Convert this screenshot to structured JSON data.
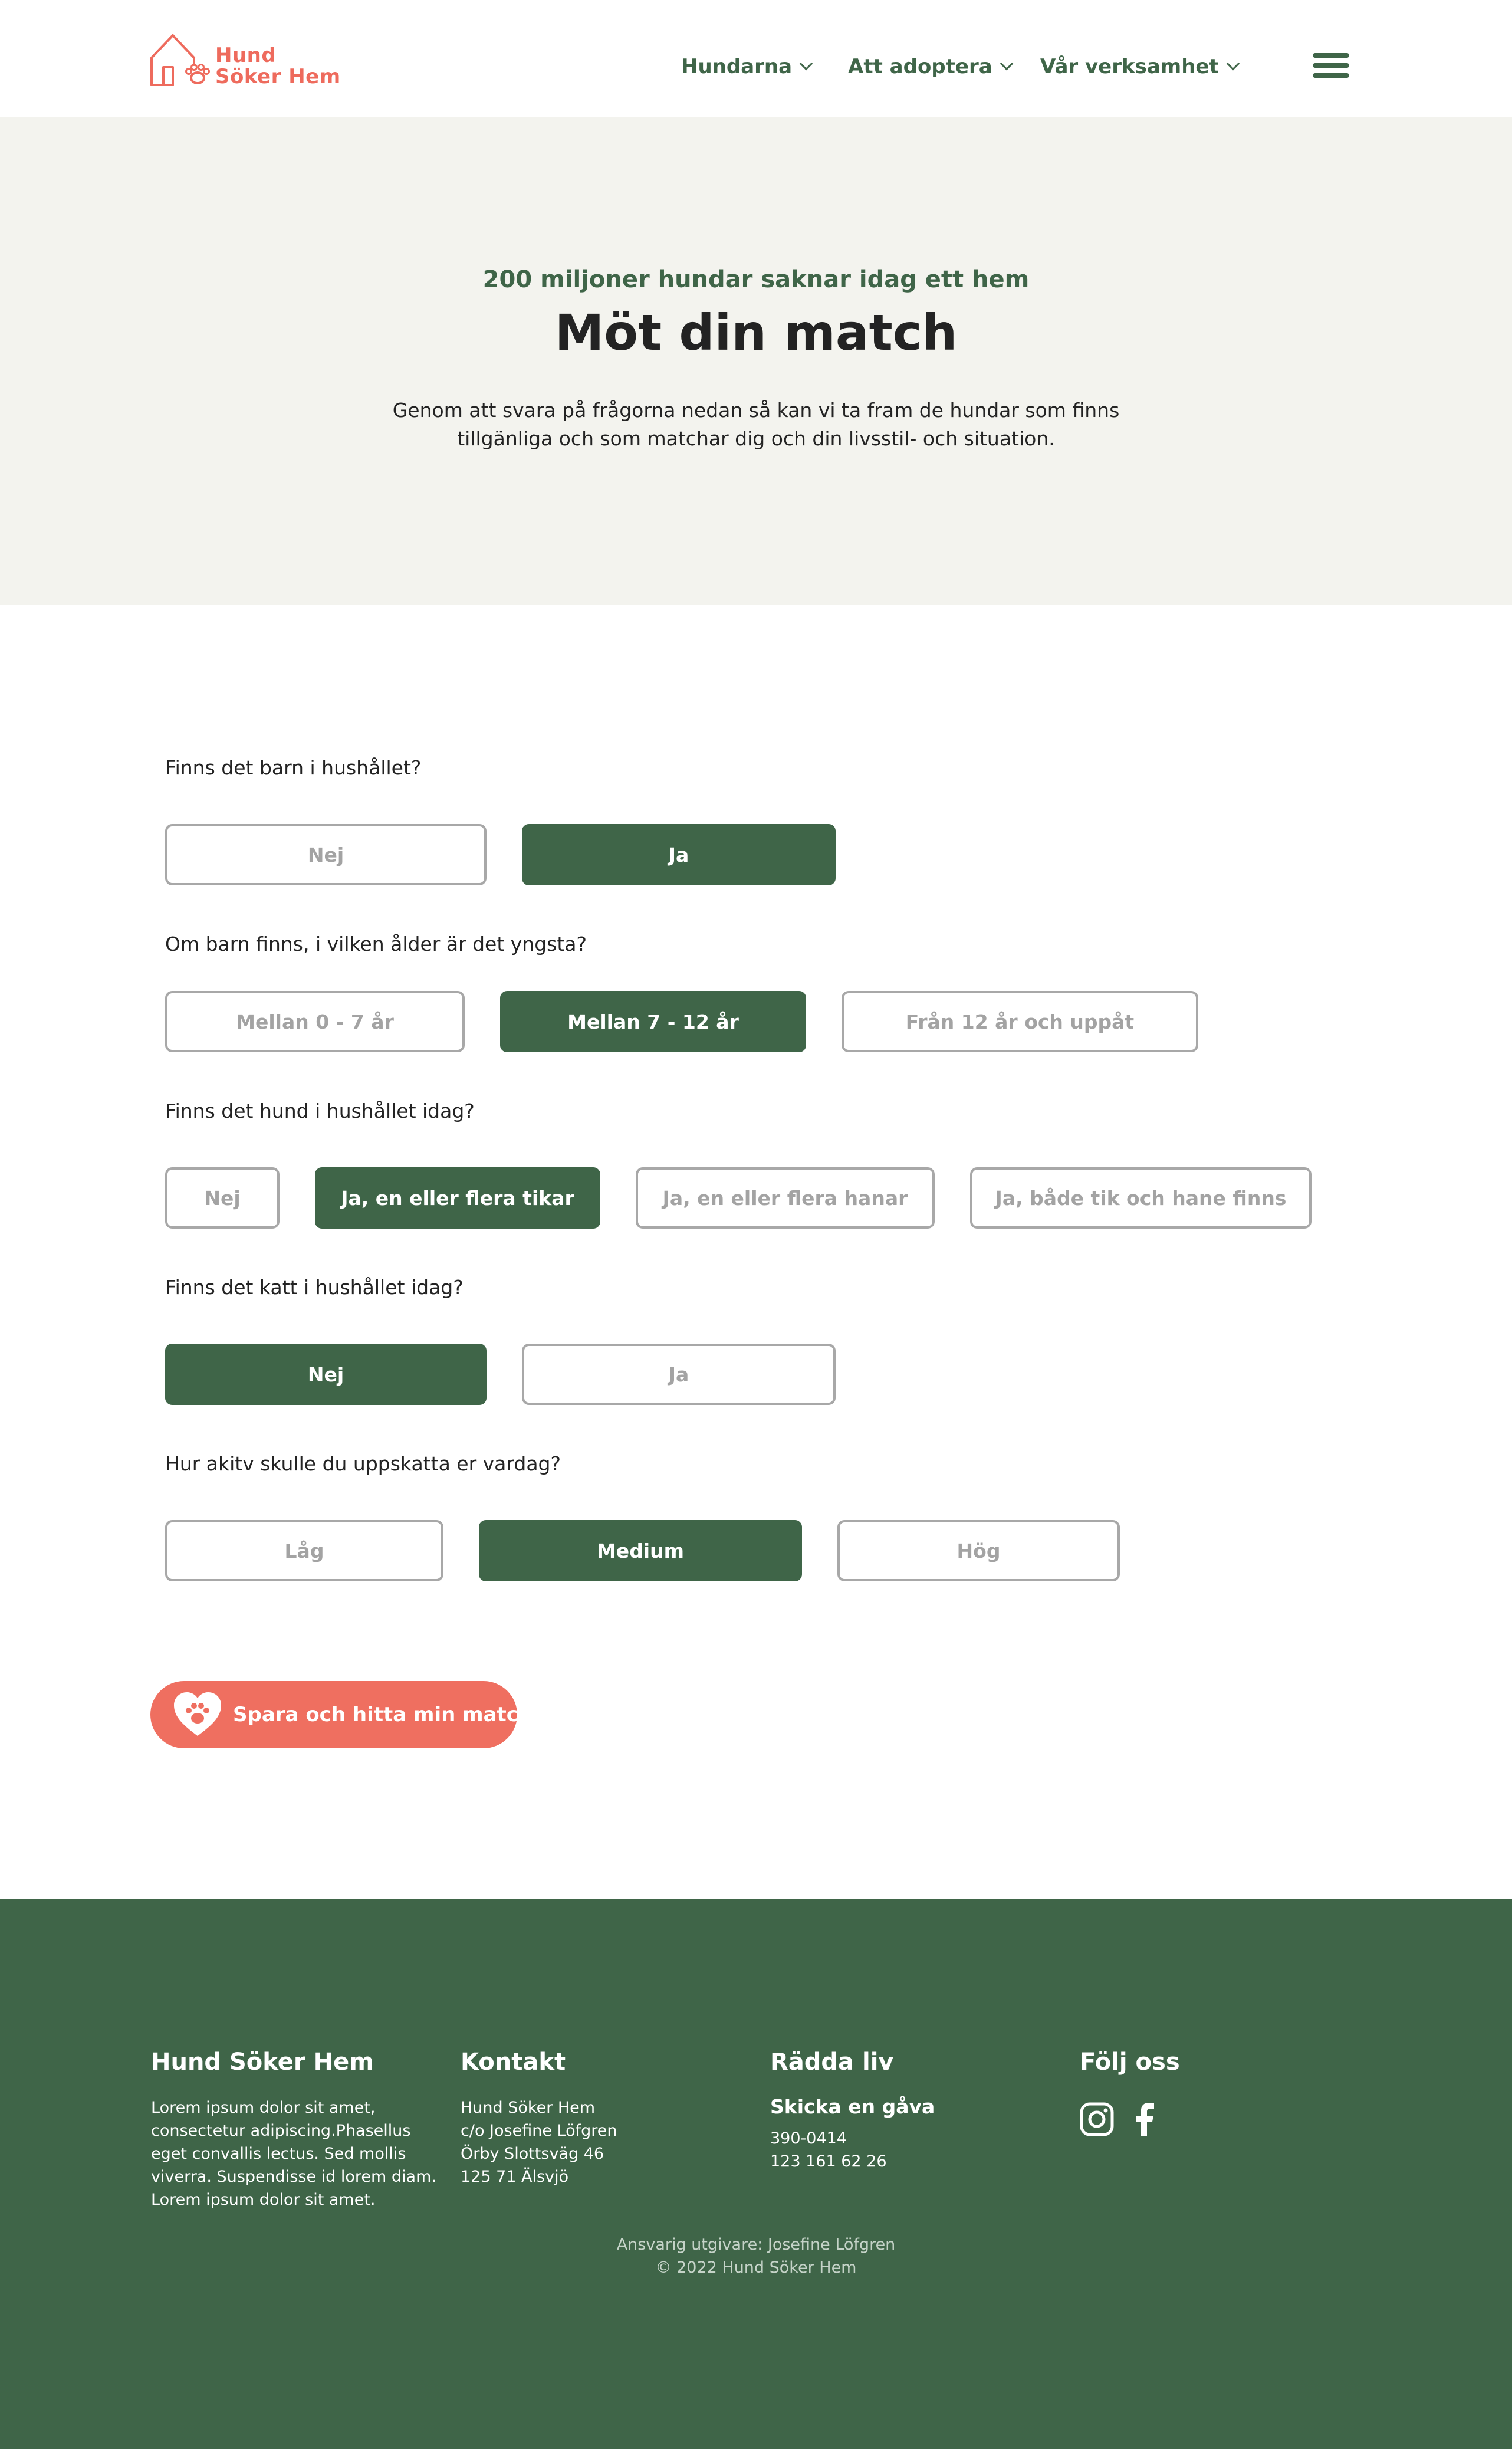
{
  "brand": {
    "name_line1": "Hund",
    "name_line2": "Söker Hem",
    "accent": "#ee6b5d",
    "primary": "#3f6548"
  },
  "nav": {
    "items": [
      {
        "label": "Hundarna"
      },
      {
        "label": "Att adoptera"
      },
      {
        "label": "Vår verksamhet"
      }
    ],
    "menu_icon": "hamburger-icon"
  },
  "hero": {
    "eyebrow": "200 miljoner hundar saknar idag ett hem",
    "title": "Möt din match",
    "text": "Genom att svara på frågorna nedan så kan vi ta fram de hundar som finns tillgänliga och som matchar dig och din livsstil- och situation."
  },
  "quiz": {
    "questions": [
      {
        "text": "Finns det barn i hushållet?",
        "options": [
          {
            "label": "Nej",
            "selected": false
          },
          {
            "label": "Ja",
            "selected": true
          }
        ]
      },
      {
        "text": "Om barn finns, i vilken ålder är det yngsta?",
        "options": [
          {
            "label": "Mellan 0 - 7 år",
            "selected": false
          },
          {
            "label": "Mellan 7 - 12 år",
            "selected": true
          },
          {
            "label": "Från 12 år och uppåt",
            "selected": false
          }
        ]
      },
      {
        "text": "Finns det hund i hushållet idag?",
        "options": [
          {
            "label": "Nej",
            "selected": false
          },
          {
            "label": "Ja, en eller flera tikar",
            "selected": true
          },
          {
            "label": "Ja, en eller flera hanar",
            "selected": false
          },
          {
            "label": "Ja, både tik och hane finns",
            "selected": false
          }
        ]
      },
      {
        "text": "Finns det katt i hushållet idag?",
        "options": [
          {
            "label": "Nej",
            "selected": true
          },
          {
            "label": "Ja",
            "selected": false
          }
        ]
      },
      {
        "text": "Hur akitv skulle du uppskatta er vardag?",
        "options": [
          {
            "label": "Låg",
            "selected": false
          },
          {
            "label": "Medium",
            "selected": true
          },
          {
            "label": "Hög",
            "selected": false
          }
        ]
      }
    ],
    "submit_label": "Spara och hitta min match",
    "submit_icon": "heart-paw-icon"
  },
  "footer": {
    "about": {
      "heading": "Hund Söker Hem",
      "lines": [
        "Lorem ipsum dolor sit amet,",
        "consectetur adipiscing.Phasellus",
        "eget convallis lectus. Sed mollis",
        "viverra. Suspendisse id lorem diam.",
        "Lorem ipsum dolor sit amet."
      ]
    },
    "contact": {
      "heading": "Kontakt",
      "lines": [
        "Hund Söker Hem",
        "c/o Josefine Löfgren",
        "Örby Slottsväg 46",
        "125 71 Älsvjö"
      ]
    },
    "donate": {
      "heading": "Rädda liv",
      "subheading": "Skicka en gåva",
      "lines": [
        "390-0414",
        "123 161 62 26"
      ]
    },
    "social": {
      "heading": "Följ oss",
      "icons": [
        "instagram-icon",
        "facebook-icon"
      ]
    },
    "credits": [
      "Ansvarig utgivare: Josefine Löfgren",
      "© 2022 Hund Söker Hem"
    ]
  }
}
